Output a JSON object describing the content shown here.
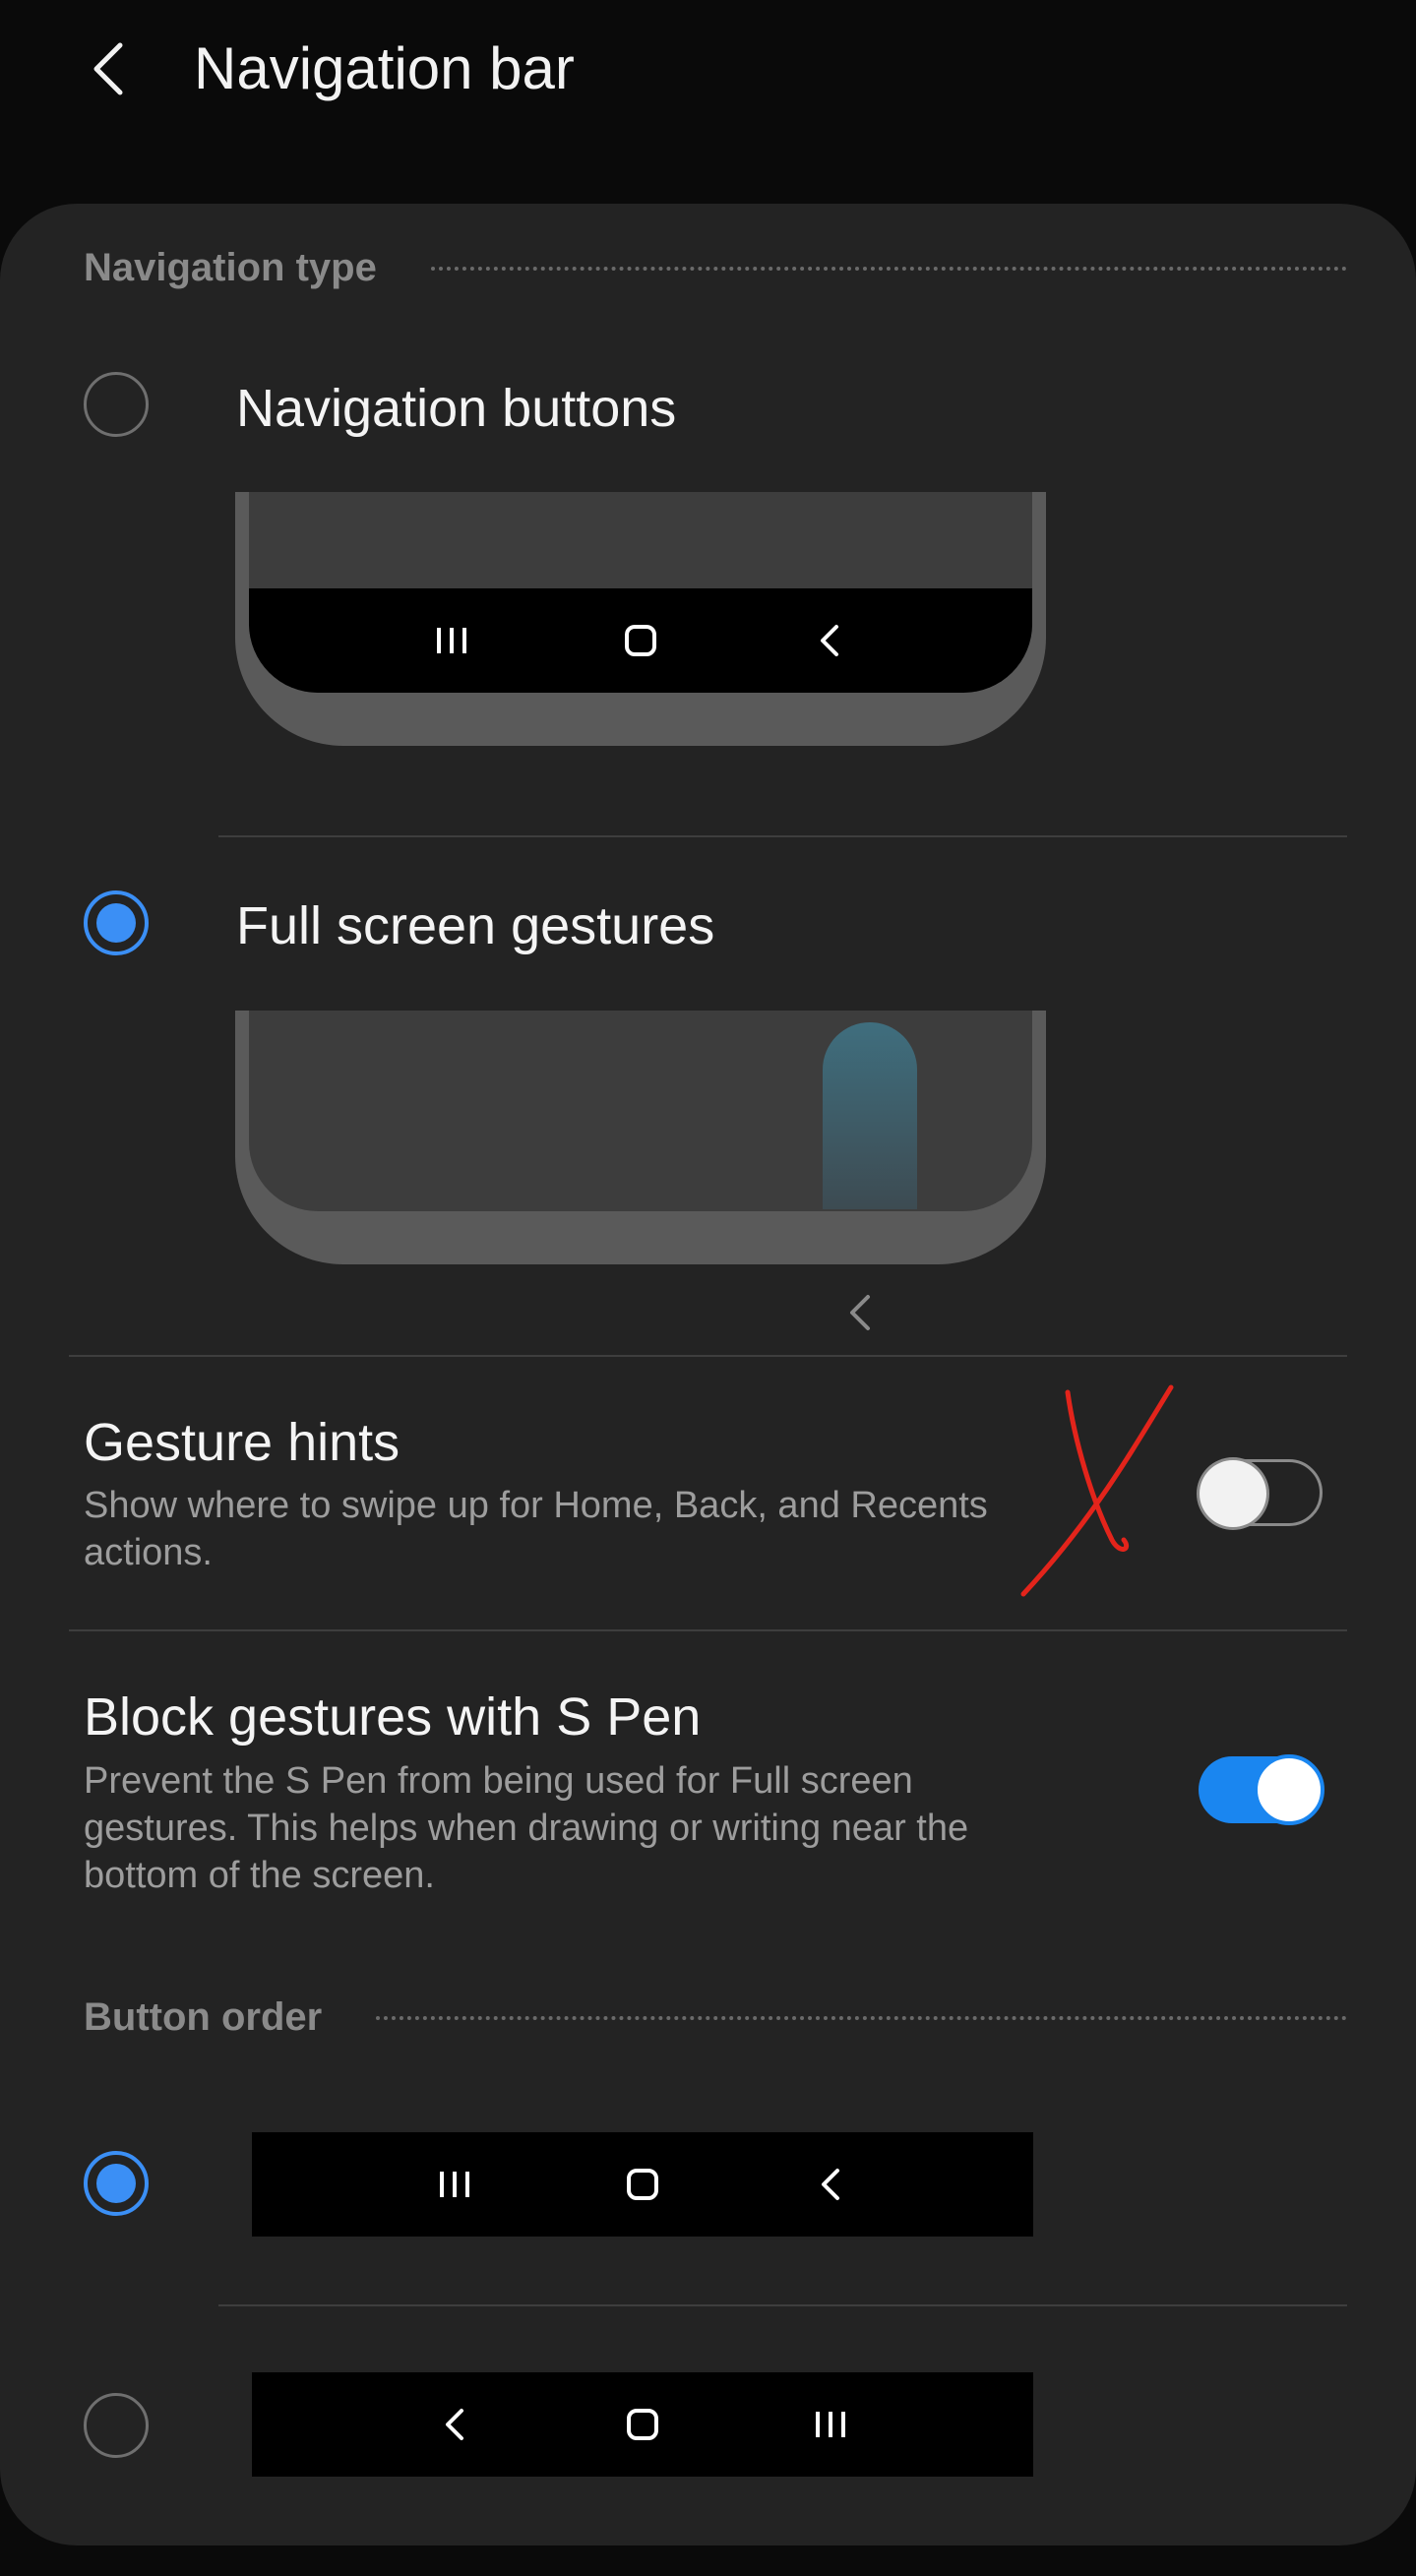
{
  "header": {
    "title": "Navigation bar",
    "back_icon": "chevron-left-icon"
  },
  "navigation_type": {
    "section_label": "Navigation type",
    "options": [
      {
        "label": "Navigation buttons",
        "selected": false,
        "icons": [
          "recents-icon",
          "home-icon",
          "back-icon"
        ]
      },
      {
        "label": "Full screen gestures",
        "selected": true,
        "icons": [
          "chevron-left-icon"
        ]
      }
    ]
  },
  "gesture_hints": {
    "title": "Gesture hints",
    "description": "Show where to swipe up for Home, Back, and Recents actions.",
    "enabled": false
  },
  "block_gestures": {
    "title": "Block gestures with S Pen",
    "description": "Prevent the S Pen from being used for Full screen gestures. This helps when drawing or writing near the bottom of the screen.",
    "enabled": true
  },
  "button_order": {
    "section_label": "Button order",
    "options": [
      {
        "selected": true,
        "icons": [
          "recents-icon",
          "home-icon",
          "back-icon"
        ]
      },
      {
        "selected": false,
        "icons": [
          "back-icon",
          "home-icon",
          "recents-icon"
        ]
      }
    ]
  },
  "colors": {
    "accent": "#3b8ff5",
    "toggle_on": "#1a86f0",
    "card_background": "#232323",
    "page_background": "#0a0a0a",
    "annotation_red": "#e3241b"
  }
}
